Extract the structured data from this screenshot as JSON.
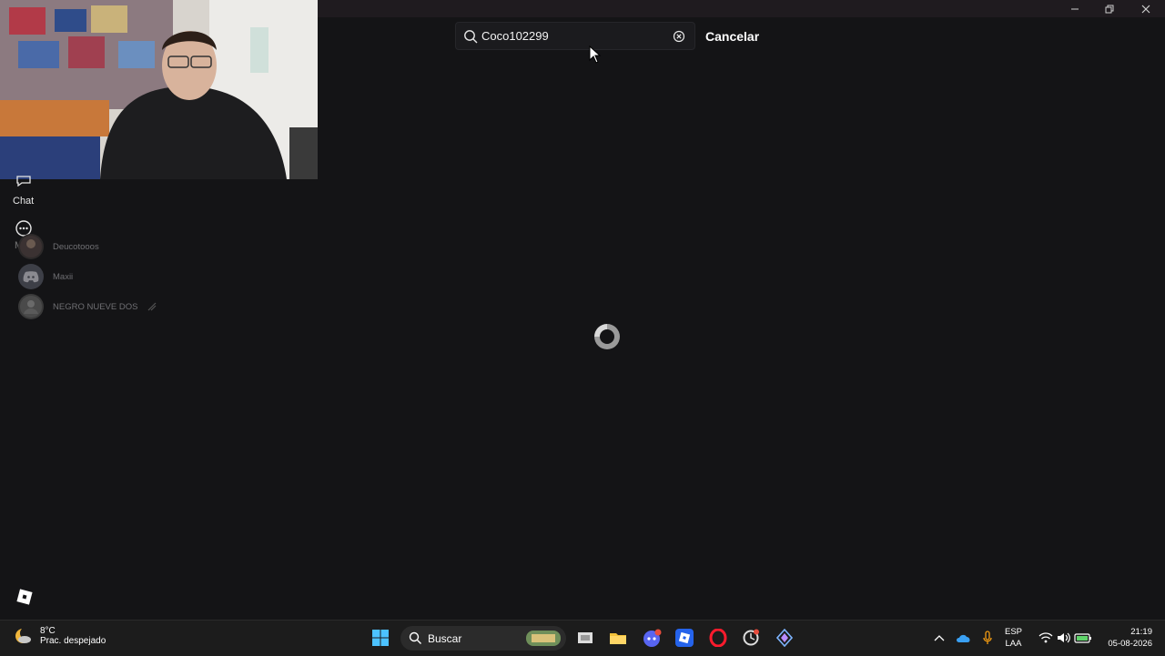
{
  "search": {
    "value": "Coco102299"
  },
  "header": {
    "cancel_label": "Cancelar"
  },
  "sidebar": {
    "chat_label": "Chat",
    "more_label": "Más",
    "friends": [
      {
        "name": "Deucotooos"
      },
      {
        "name": "Maxii"
      },
      {
        "name": "NEGRO NUEVE DOS"
      }
    ]
  },
  "taskbar": {
    "weather_temp": "8°C",
    "weather_desc": "Prac. despejado",
    "search_label": "Buscar",
    "lang_line1": "ESP",
    "lang_line2": "LAA",
    "time": "21:19",
    "date": "05-08-2026"
  },
  "colors": {
    "background": "#141416",
    "taskbar": "#1c1c1c",
    "accent_blue": "#3b82f6"
  }
}
